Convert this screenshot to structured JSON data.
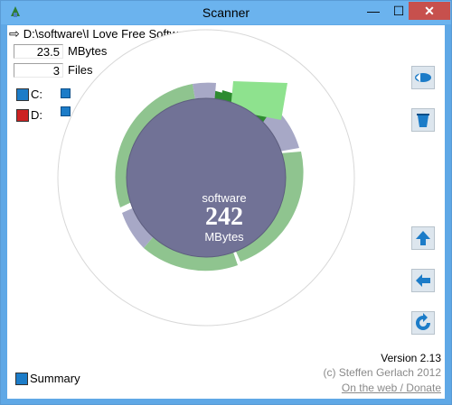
{
  "window": {
    "title": "Scanner"
  },
  "controls": {
    "minimize": "—",
    "maximize": "☐",
    "close": "✕"
  },
  "path": {
    "arrow": "⇨",
    "value": "D:\\software\\I Love Free Software"
  },
  "stats": [
    {
      "value": "23.5",
      "unit": "MBytes"
    },
    {
      "value": "3",
      "unit": "Files"
    }
  ],
  "drives": [
    {
      "label": "C:",
      "color": "#1c7cc8"
    },
    {
      "label": "D:",
      "color": "#cc2222"
    }
  ],
  "center": {
    "name": "software",
    "size": "242",
    "unit": "MBytes"
  },
  "footer": {
    "version": "Version 2.13",
    "copyright": "(c) Steffen Gerlach 2012",
    "link": "On the web / Donate",
    "summary": "Summary"
  },
  "icons": [
    "expand-icon",
    "trash-icon",
    "up-icon",
    "back-icon",
    "refresh-icon"
  ]
}
